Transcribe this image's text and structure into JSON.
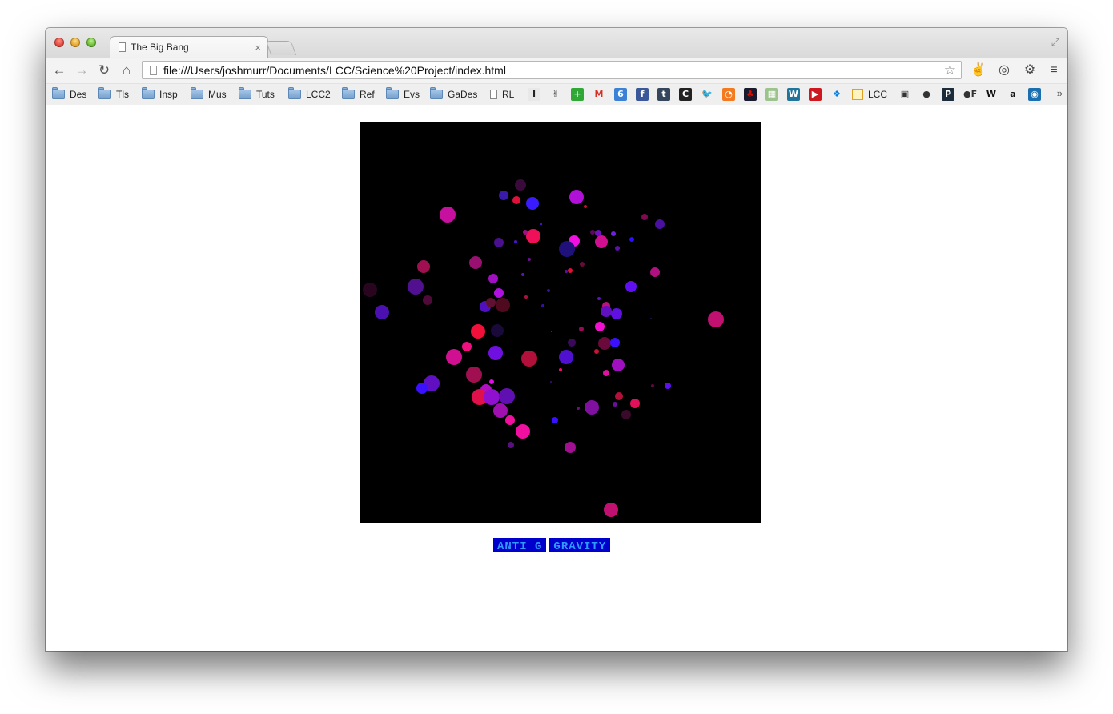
{
  "browser": {
    "tab_title": "The Big Bang",
    "tab_close": "×",
    "url": "file:///Users/joshmurr/Documents/LCC/Science%20Project/index.html",
    "nav": {
      "back": "←",
      "forward": "→",
      "reload": "↻",
      "home": "⌂"
    },
    "star": "☆",
    "fullscreen": "⤢",
    "extensions": [
      {
        "name": "peace-extension-icon",
        "glyph": "✌"
      },
      {
        "name": "circle-extension-icon",
        "glyph": "◎"
      },
      {
        "name": "settings-icon",
        "glyph": "⚙"
      },
      {
        "name": "menu-icon",
        "glyph": "≡"
      }
    ],
    "bookmarks": {
      "folders": [
        "Des",
        "Tls",
        "Insp",
        "Mus",
        "Tuts",
        "LCC2",
        "Ref",
        "Evs",
        "GaDes"
      ],
      "page": "RL",
      "icons": [
        {
          "name": "instapaper-icon",
          "glyph": "I",
          "color": "#e8e8e8",
          "fg": "#222"
        },
        {
          "name": "peace-icon",
          "glyph": "✌",
          "color": "#efefef",
          "fg": "#222"
        },
        {
          "name": "plus-icon",
          "glyph": "+",
          "color": "#2fa836",
          "fg": "#fff"
        },
        {
          "name": "gmail-icon",
          "glyph": "M",
          "color": "#efefef",
          "fg": "#d93025"
        },
        {
          "name": "calendar-icon",
          "glyph": "6",
          "color": "#3b82d6",
          "fg": "#fff"
        },
        {
          "name": "facebook-icon",
          "glyph": "f",
          "color": "#3b5998",
          "fg": "#fff"
        },
        {
          "name": "tumblr-icon",
          "glyph": "t",
          "color": "#35465c",
          "fg": "#fff"
        },
        {
          "name": "c-icon",
          "glyph": "C",
          "color": "#222",
          "fg": "#fff"
        },
        {
          "name": "twitter-icon",
          "glyph": "🐦",
          "color": "#efefef",
          "fg": "#1da1f2"
        },
        {
          "name": "orange-icon",
          "glyph": "◔",
          "color": "#f47a20",
          "fg": "#fff"
        },
        {
          "name": "lastfm-icon",
          "glyph": "♣",
          "color": "#1a1a2e",
          "fg": "#d51007"
        },
        {
          "name": "maps-icon",
          "glyph": "▦",
          "color": "#9bc38b",
          "fg": "#fff"
        },
        {
          "name": "wordpress-icon",
          "glyph": "W",
          "color": "#21759b",
          "fg": "#fff"
        },
        {
          "name": "youtube-icon",
          "glyph": "▶",
          "color": "#cc181e",
          "fg": "#fff"
        },
        {
          "name": "dropbox-icon",
          "glyph": "❖",
          "color": "#efefef",
          "fg": "#007ee5"
        }
      ],
      "lcc_label": "LCC",
      "icons2": [
        {
          "name": "gift-icon",
          "glyph": "▣",
          "color": "#efefef",
          "fg": "#333"
        },
        {
          "name": "github-icon",
          "glyph": "●",
          "color": "#efefef",
          "fg": "#333"
        },
        {
          "name": "p-icon",
          "glyph": "P",
          "color": "#1c2b3a",
          "fg": "#fff"
        },
        {
          "name": "of-icon",
          "glyph": "●F",
          "color": "#efefef",
          "fg": "#333"
        },
        {
          "name": "w-icon",
          "glyph": "W",
          "color": "#efefef",
          "fg": "#111"
        },
        {
          "name": "amazon-icon",
          "glyph": "a",
          "color": "#efefef",
          "fg": "#111"
        },
        {
          "name": "globe-icon",
          "glyph": "◉",
          "color": "#1a6fb0",
          "fg": "#fff"
        }
      ],
      "more": "»"
    }
  },
  "page": {
    "buttons": {
      "anti_g": "ANTI G",
      "gravity": "GRAVITY"
    },
    "particles": [
      [
        650,
        231,
        7,
        "#3a0a3a"
      ],
      [
        629,
        244,
        6,
        "#3a1aa8"
      ],
      [
        645,
        250,
        5,
        "#e0103a"
      ],
      [
        665,
        254,
        8,
        "#3a1aff"
      ],
      [
        720,
        246,
        9,
        "#b010d8"
      ],
      [
        731,
        258,
        2,
        "#c0103a"
      ],
      [
        559,
        268,
        10,
        "#c810a0"
      ],
      [
        666,
        295,
        9,
        "#f0105a"
      ],
      [
        676,
        280,
        1,
        "#6010ff"
      ],
      [
        656,
        290,
        3,
        "#a01080"
      ],
      [
        644,
        302,
        2,
        "#5010d0"
      ],
      [
        623,
        303,
        6,
        "#4a1090"
      ],
      [
        717,
        301,
        7,
        "#f010e0"
      ],
      [
        708,
        311,
        10,
        "#20107a"
      ],
      [
        751,
        302,
        8,
        "#d01090"
      ],
      [
        747,
        291,
        4,
        "#7010c0"
      ],
      [
        740,
        290,
        3,
        "#5a0a5a"
      ],
      [
        766,
        292,
        3,
        "#7020e0"
      ],
      [
        771,
        310,
        3,
        "#6010b0"
      ],
      [
        789,
        299,
        3,
        "#2a10ff"
      ],
      [
        805,
        271,
        4,
        "#800a50"
      ],
      [
        824,
        280,
        6,
        "#4a10a0"
      ],
      [
        529,
        333,
        8,
        "#a01050"
      ],
      [
        594,
        328,
        8,
        "#9a1070"
      ],
      [
        661,
        324,
        2,
        "#6a1090"
      ],
      [
        727,
        330,
        3,
        "#6a0a3a"
      ],
      [
        712,
        338,
        3,
        "#e0103a"
      ],
      [
        707,
        339,
        2,
        "#6010a0"
      ],
      [
        818,
        340,
        6,
        "#b01080"
      ],
      [
        616,
        348,
        6,
        "#a010c0"
      ],
      [
        653,
        343,
        2,
        "#6010c0"
      ],
      [
        519,
        358,
        10,
        "#501090"
      ],
      [
        462,
        362,
        9,
        "#2a0520"
      ],
      [
        623,
        366,
        6,
        "#b010e0"
      ],
      [
        685,
        363,
        2,
        "#3a10a0"
      ],
      [
        657,
        371,
        2,
        "#b01040"
      ],
      [
        788,
        358,
        7,
        "#6010f0"
      ],
      [
        534,
        375,
        6,
        "#500a3a"
      ],
      [
        606,
        383,
        7,
        "#5010c0"
      ],
      [
        628,
        381,
        9,
        "#500a20"
      ],
      [
        613,
        378,
        6,
        "#601030"
      ],
      [
        678,
        382,
        2,
        "#3a10a0"
      ],
      [
        748,
        373,
        2,
        "#6010c0"
      ],
      [
        757,
        382,
        5,
        "#c01080"
      ],
      [
        757,
        389,
        7,
        "#6010c0"
      ],
      [
        770,
        392,
        7,
        "#6010e0"
      ],
      [
        477,
        390,
        9,
        "#4a10b0"
      ],
      [
        894,
        399,
        10,
        "#c01070"
      ],
      [
        597,
        414,
        9,
        "#f0103a"
      ],
      [
        621,
        413,
        8,
        "#1a0a3a"
      ],
      [
        749,
        408,
        6,
        "#f010d0"
      ],
      [
        726,
        411,
        3,
        "#9a0a5a"
      ],
      [
        689,
        414,
        1,
        "#c01050"
      ],
      [
        813,
        398,
        1,
        "#2a1060"
      ],
      [
        583,
        433,
        6,
        "#f01080"
      ],
      [
        619,
        441,
        9,
        "#7010e0"
      ],
      [
        714,
        428,
        5,
        "#3a0a5a"
      ],
      [
        755,
        429,
        8,
        "#6a0a3a"
      ],
      [
        768,
        428,
        6,
        "#3a10ff"
      ],
      [
        567,
        446,
        10,
        "#d01090"
      ],
      [
        661,
        448,
        10,
        "#b0103a"
      ],
      [
        707,
        446,
        9,
        "#5010d0"
      ],
      [
        745,
        439,
        3,
        "#d01030"
      ],
      [
        772,
        456,
        8,
        "#a010c0"
      ],
      [
        700,
        462,
        2,
        "#f01070"
      ],
      [
        757,
        466,
        4,
        "#e010a0"
      ],
      [
        592,
        468,
        10,
        "#a01050"
      ],
      [
        614,
        477,
        3,
        "#e010e0"
      ],
      [
        688,
        477,
        1,
        "#3a1080"
      ],
      [
        815,
        482,
        2,
        "#600a40"
      ],
      [
        834,
        482,
        4,
        "#6010f0"
      ],
      [
        539,
        479,
        10,
        "#6010c0"
      ],
      [
        527,
        485,
        7,
        "#3a10ff"
      ],
      [
        607,
        487,
        7,
        "#b010c0"
      ],
      [
        599,
        496,
        10,
        "#e0104a"
      ],
      [
        614,
        496,
        10,
        "#9010d0"
      ],
      [
        633,
        495,
        10,
        "#6010b0"
      ],
      [
        773,
        495,
        5,
        "#b0103a"
      ],
      [
        793,
        504,
        6,
        "#e0105a"
      ],
      [
        768,
        505,
        3,
        "#6a10a0"
      ],
      [
        722,
        510,
        2,
        "#6a1080"
      ],
      [
        739,
        509,
        9,
        "#8010a0"
      ],
      [
        782,
        518,
        6,
        "#3a0a2a"
      ],
      [
        625,
        513,
        9,
        "#a010b0"
      ],
      [
        637,
        525,
        6,
        "#f010a0"
      ],
      [
        693,
        525,
        4,
        "#3a10ff"
      ],
      [
        653,
        539,
        9,
        "#f010a0"
      ],
      [
        638,
        556,
        4,
        "#5a1080"
      ],
      [
        712,
        559,
        7,
        "#a01090"
      ],
      [
        763,
        637,
        9,
        "#c01070"
      ]
    ]
  }
}
